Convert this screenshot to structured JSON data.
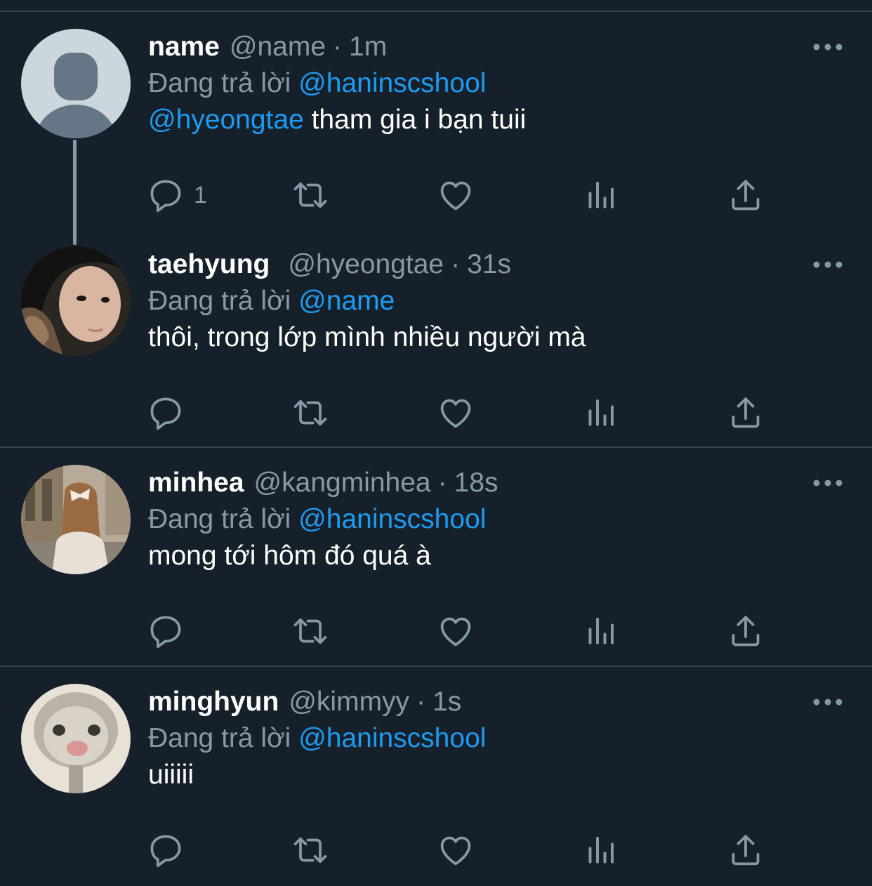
{
  "tweets": [
    {
      "display_name": "name",
      "handle": "@name",
      "time": "1m",
      "replying_label": "Đang trả lời",
      "replying_to": "@haninscshool",
      "text_mention": "@hyeongtae",
      "text": " tham gia i bạn tuii",
      "reply_count": "1",
      "avatar": "default-avatar"
    },
    {
      "display_name": "taehyung",
      "handle": "@hyeongtae",
      "time": "31s",
      "replying_label": "Đang trả lời",
      "replying_to": "@name",
      "text": "thôi, trong lớp mình nhiều người mà",
      "avatar": "photo-avatar"
    },
    {
      "display_name": "minhea",
      "handle": "@kangminhea",
      "time": "18s",
      "replying_label": "Đang trả lời",
      "replying_to": "@haninscshool",
      "text": "mong tới hôm đó quá à",
      "avatar": "photo-avatar"
    },
    {
      "display_name": "minghyun",
      "handle": "@kimmyy",
      "time": "1s",
      "replying_label": "Đang trả lời",
      "replying_to": "@haninscshool",
      "text": "uiiiii",
      "avatar": "photo-avatar"
    }
  ],
  "separator": "·",
  "icons": [
    "reply-icon",
    "retweet-icon",
    "like-icon",
    "analytics-icon",
    "share-icon",
    "more-icon"
  ],
  "colors": {
    "background": "#15202b",
    "divider": "#38444d",
    "secondary_text": "#8899a6",
    "accent": "#1d9bf0",
    "primary_text": "#ffffff"
  }
}
